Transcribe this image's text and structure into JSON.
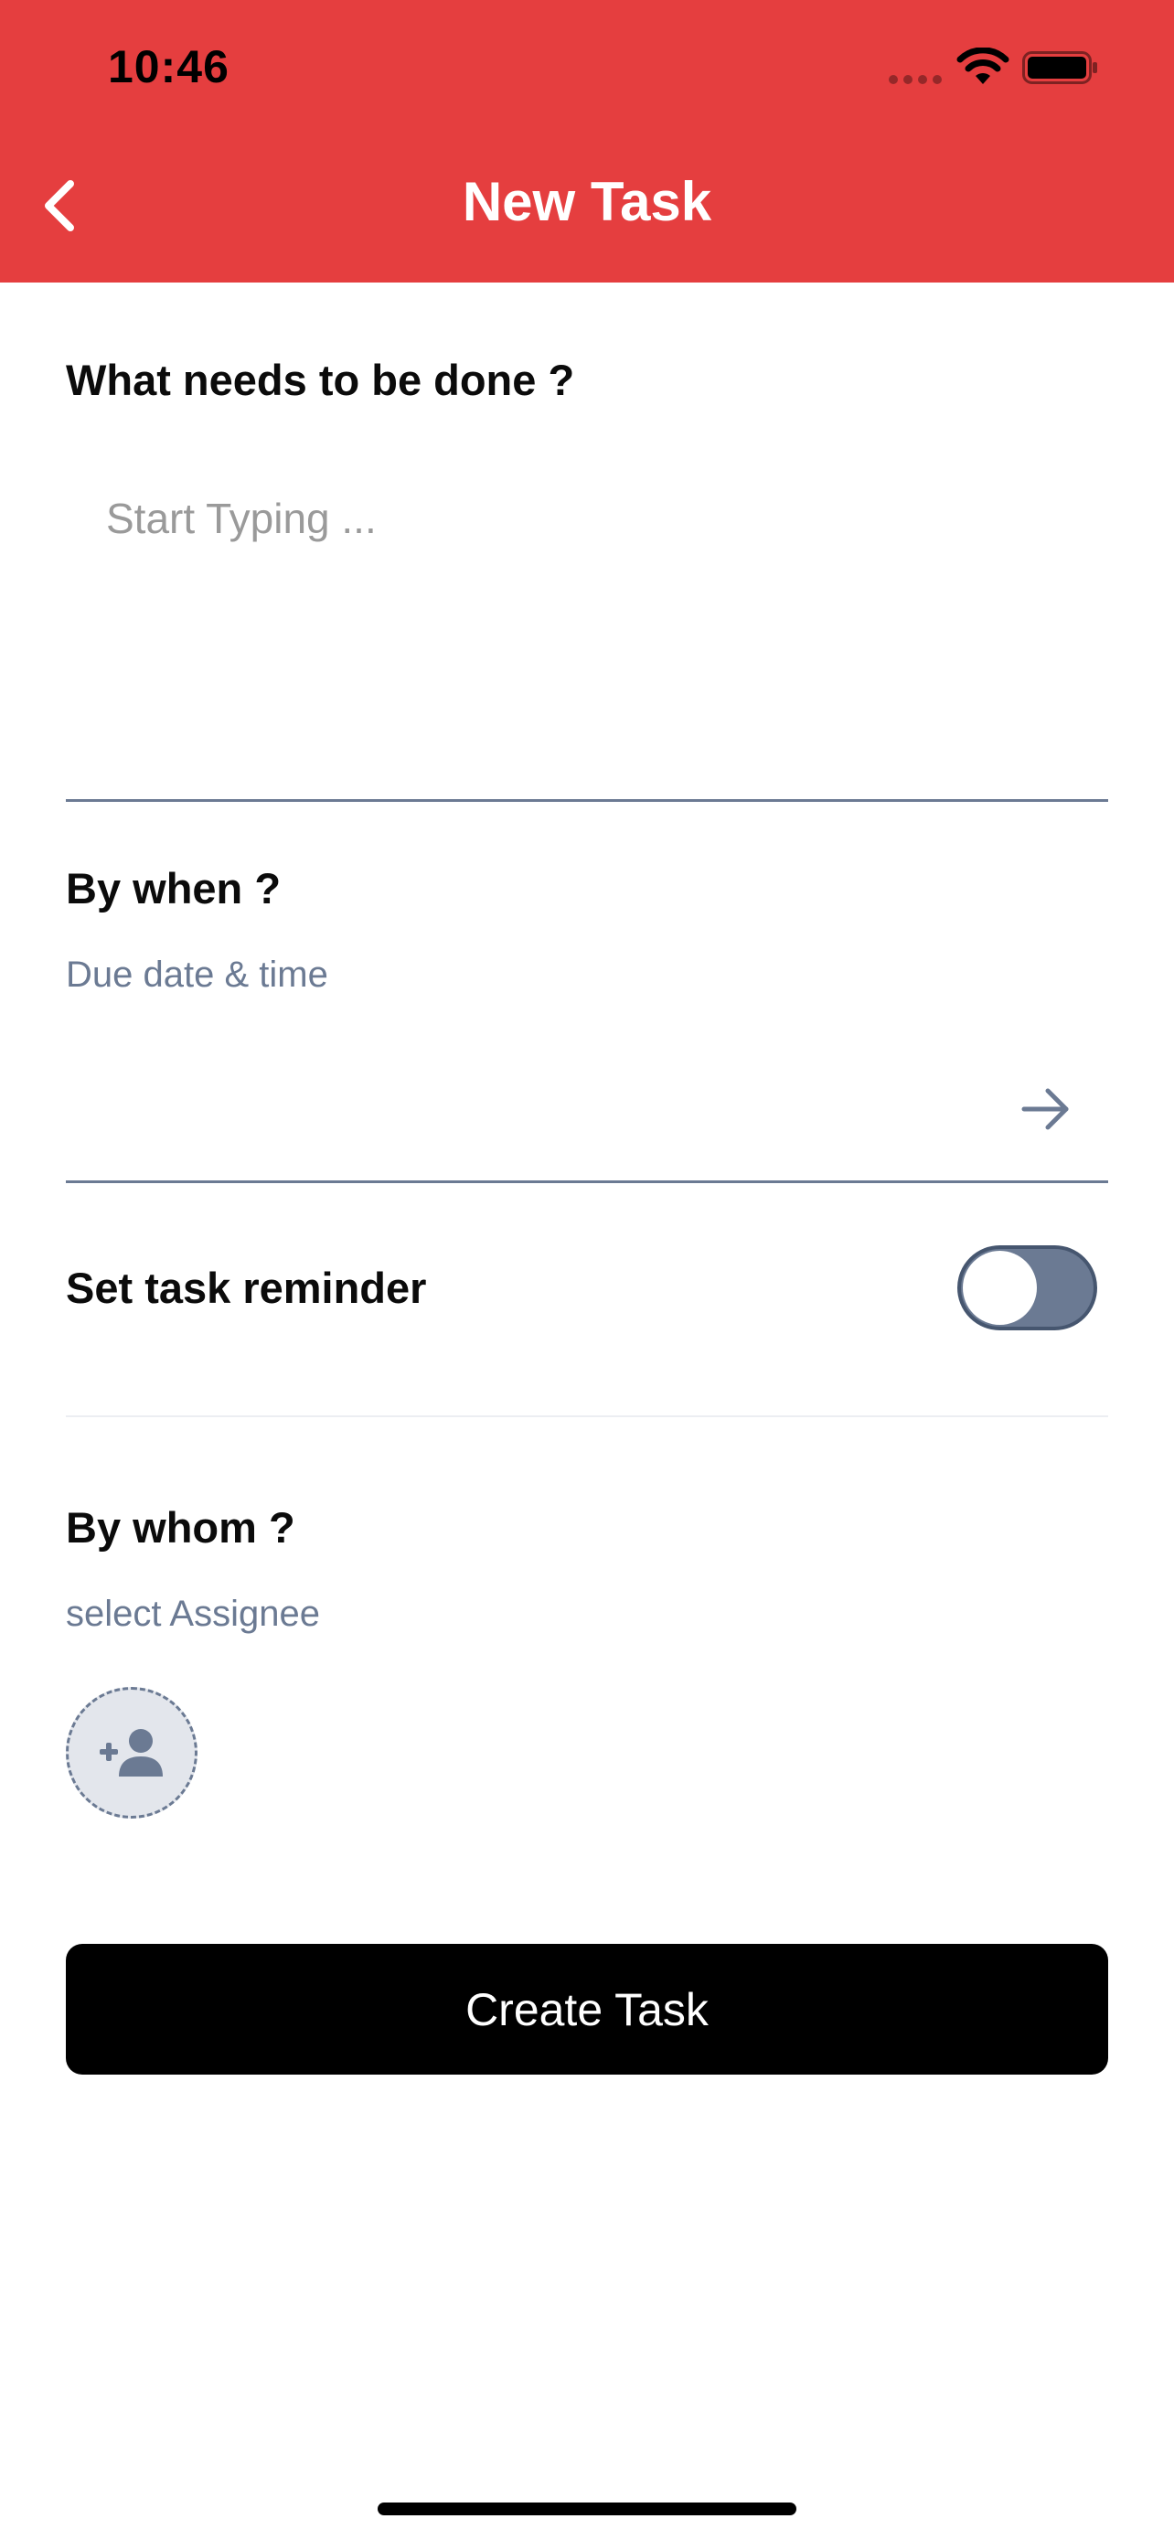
{
  "status_bar": {
    "time": "10:46"
  },
  "header": {
    "title": "New Task",
    "back_icon": "chevron-left-icon",
    "background_color": "#E53E3F"
  },
  "task": {
    "label": "What needs to be done ?",
    "placeholder": "Start Typing ..."
  },
  "due": {
    "label": "By when ?",
    "sublabel": "Due date & time",
    "icon": "arrow-right-icon"
  },
  "reminder": {
    "label": "Set task reminder",
    "enabled": false
  },
  "assignee": {
    "label": "By whom ?",
    "sublabel": "select Assignee",
    "icon": "add-user-icon"
  },
  "actions": {
    "create_label": "Create Task"
  },
  "colors": {
    "accent": "#E53E3F",
    "muted": "#6B7A93",
    "button": "#000000"
  }
}
